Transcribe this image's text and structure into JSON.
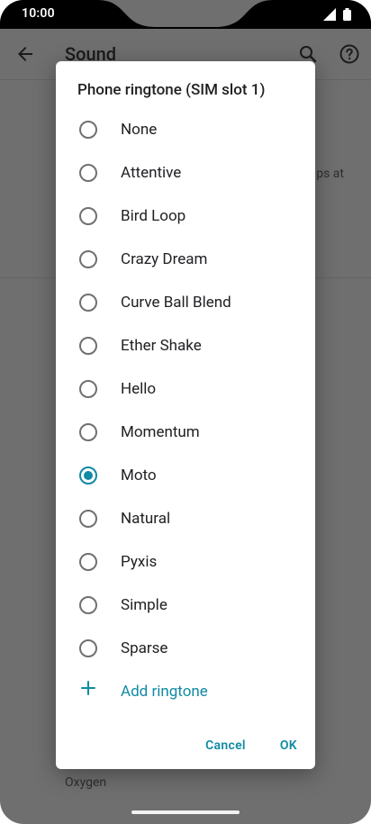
{
  "status_bar": {
    "time": "10:00"
  },
  "app_bar": {
    "title": "Sound"
  },
  "background": {
    "snippet": "ps at",
    "footer_text": "Oxygen"
  },
  "dialog": {
    "title": "Phone ringtone (SIM slot 1)",
    "options": [
      {
        "label": "None",
        "selected": false
      },
      {
        "label": "Attentive",
        "selected": false
      },
      {
        "label": "Bird Loop",
        "selected": false
      },
      {
        "label": "Crazy Dream",
        "selected": false
      },
      {
        "label": "Curve Ball Blend",
        "selected": false
      },
      {
        "label": "Ether Shake",
        "selected": false
      },
      {
        "label": "Hello",
        "selected": false
      },
      {
        "label": "Momentum",
        "selected": false
      },
      {
        "label": "Moto",
        "selected": true
      },
      {
        "label": "Natural",
        "selected": false
      },
      {
        "label": "Pyxis",
        "selected": false
      },
      {
        "label": "Simple",
        "selected": false
      },
      {
        "label": "Sparse",
        "selected": false
      }
    ],
    "add_label": "Add ringtone",
    "cancel_label": "Cancel",
    "ok_label": "OK"
  },
  "colors": {
    "accent": "#118aa3",
    "scrim": "#6f6f6f"
  }
}
